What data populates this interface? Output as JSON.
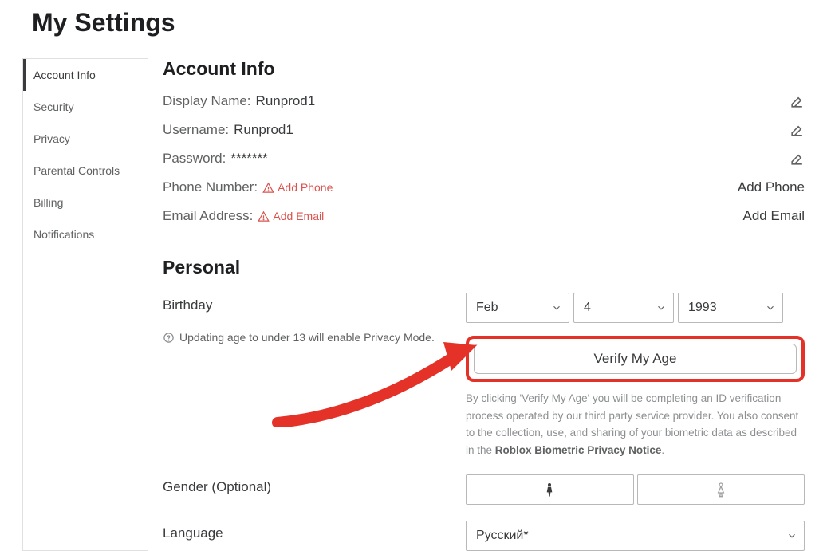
{
  "page_title": "My Settings",
  "sidebar": {
    "items": [
      {
        "label": "Account Info",
        "active": true
      },
      {
        "label": "Security",
        "active": false
      },
      {
        "label": "Privacy",
        "active": false
      },
      {
        "label": "Parental Controls",
        "active": false
      },
      {
        "label": "Billing",
        "active": false
      },
      {
        "label": "Notifications",
        "active": false
      }
    ]
  },
  "account": {
    "title": "Account Info",
    "display_name_label": "Display Name:",
    "display_name_value": "Runprod1",
    "username_label": "Username:",
    "username_value": "Runprod1",
    "password_label": "Password:",
    "password_value": "*******",
    "phone_label": "Phone Number:",
    "phone_inline_link": "Add Phone",
    "phone_right": "Add Phone",
    "email_label": "Email Address:",
    "email_inline_link": "Add Email",
    "email_right": "Add Email"
  },
  "personal": {
    "title": "Personal",
    "birthday_label": "Birthday",
    "birthday_month": "Feb",
    "birthday_day": "4",
    "birthday_year": "1993",
    "age_note": "Updating age to under 13 will enable Privacy Mode.",
    "verify_button": "Verify My Age",
    "disclaimer_pre": "By clicking 'Verify My Age' you will be completing an ID verification process operated by our third party service provider. You also consent to the collection, use, and sharing of your biometric data as described in the ",
    "disclaimer_link": "Roblox Biometric Privacy Notice",
    "disclaimer_post": ".",
    "gender_label": "Gender (Optional)",
    "language_label": "Language",
    "language_value": "Русский*"
  }
}
